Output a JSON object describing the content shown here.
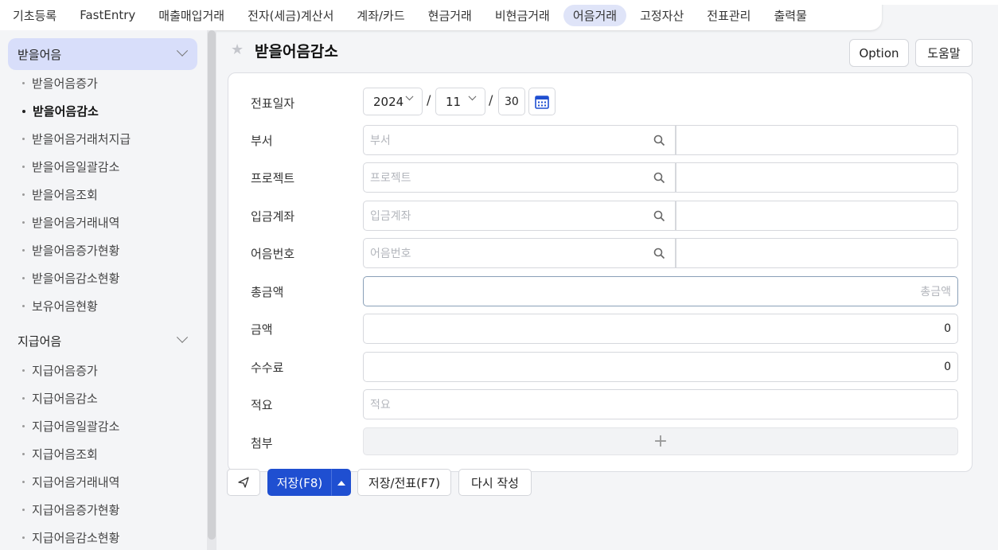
{
  "nav": {
    "tabs": [
      "기초등록",
      "FastEntry",
      "매출매입거래",
      "전자(세금)계산서",
      "계좌/카드",
      "현금거래",
      "비현금거래",
      "어음거래",
      "고정자산",
      "전표관리",
      "출력물"
    ],
    "active_index": 7
  },
  "sidebar": {
    "group1": {
      "label": "받을어음",
      "items": [
        "받을어음증가",
        "받을어음감소",
        "받을어음거래처지급",
        "받을어음일괄감소",
        "받을어음조회",
        "받을어음거래내역",
        "받을어음증가현황",
        "받을어음감소현황",
        "보유어음현황"
      ],
      "active_index": 1
    },
    "group2": {
      "label": "지급어음",
      "items": [
        "지급어음증가",
        "지급어음감소",
        "지급어음일괄감소",
        "지급어음조회",
        "지급어음거래내역",
        "지급어음증가현황",
        "지급어음감소현황"
      ]
    }
  },
  "header": {
    "title": "받을어음감소",
    "option_label": "Option",
    "help_label": "도움말"
  },
  "form": {
    "date": {
      "label": "전표일자",
      "year": "2024",
      "month": "11",
      "day": "30",
      "sep": "/"
    },
    "dept": {
      "label": "부서",
      "placeholder": "부서"
    },
    "project": {
      "label": "프로젝트",
      "placeholder": "프로젝트"
    },
    "account": {
      "label": "입금계좌",
      "placeholder": "입금계좌"
    },
    "note_no": {
      "label": "어음번호",
      "placeholder": "어음번호"
    },
    "total": {
      "label": "총금액",
      "placeholder": "총금액"
    },
    "amount": {
      "label": "금액",
      "value": "0"
    },
    "fee": {
      "label": "수수료",
      "value": "0"
    },
    "memo": {
      "label": "적요",
      "placeholder": "적요"
    },
    "attach": {
      "label": "첨부",
      "plus": "+"
    }
  },
  "actions": {
    "save": "저장(F8)",
    "save_voucher": "저장/전표(F7)",
    "rewrite": "다시 작성"
  },
  "colors": {
    "primary": "#1f4fd1",
    "active_tab": "#dfe4f8",
    "active_group": "#d8defa"
  }
}
